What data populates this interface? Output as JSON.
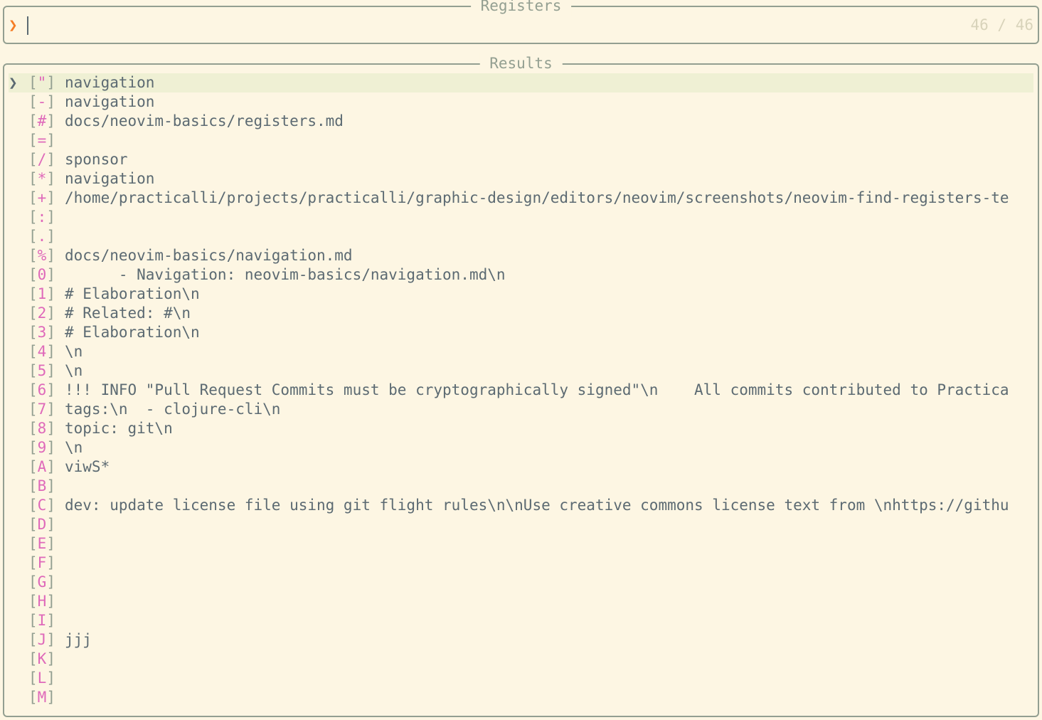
{
  "prompt": {
    "title": "Registers",
    "caret": "❯",
    "value": "",
    "count": "46 / 46"
  },
  "results": {
    "title": "Results",
    "selected_marker": "❯",
    "rows": [
      {
        "reg": "\"",
        "value": "navigation",
        "selected": true
      },
      {
        "reg": "-",
        "value": "navigation"
      },
      {
        "reg": "#",
        "value": "docs/neovim-basics/registers.md"
      },
      {
        "reg": "=",
        "value": ""
      },
      {
        "reg": "/",
        "value": "sponsor"
      },
      {
        "reg": "*",
        "value": "navigation"
      },
      {
        "reg": "+",
        "value": "/home/practicalli/projects/practicalli/graphic-design/editors/neovim/screenshots/neovim-find-registers-te"
      },
      {
        "reg": ":",
        "value": ""
      },
      {
        "reg": ".",
        "value": ""
      },
      {
        "reg": "%",
        "value": "docs/neovim-basics/navigation.md"
      },
      {
        "reg": "0",
        "value": "      - Navigation: neovim-basics/navigation.md\\n"
      },
      {
        "reg": "1",
        "value": "# Elaboration\\n"
      },
      {
        "reg": "2",
        "value": "# Related: #\\n"
      },
      {
        "reg": "3",
        "value": "# Elaboration\\n"
      },
      {
        "reg": "4",
        "value": "\\n"
      },
      {
        "reg": "5",
        "value": "\\n"
      },
      {
        "reg": "6",
        "value": "!!! INFO \"Pull Request Commits must be cryptographically signed\"\\n    All commits contributed to Practica"
      },
      {
        "reg": "7",
        "value": "tags:\\n  - clojure-cli\\n"
      },
      {
        "reg": "8",
        "value": "topic: git\\n"
      },
      {
        "reg": "9",
        "value": "\\n"
      },
      {
        "reg": "A",
        "value": "viwS*"
      },
      {
        "reg": "B",
        "value": ""
      },
      {
        "reg": "C",
        "value": "dev: update license file using git flight rules\\n\\nUse creative commons license text from \\nhttps://githu"
      },
      {
        "reg": "D",
        "value": ""
      },
      {
        "reg": "E",
        "value": ""
      },
      {
        "reg": "F",
        "value": ""
      },
      {
        "reg": "G",
        "value": ""
      },
      {
        "reg": "H",
        "value": ""
      },
      {
        "reg": "I",
        "value": ""
      },
      {
        "reg": "J",
        "value": "jjj"
      },
      {
        "reg": "K",
        "value": ""
      },
      {
        "reg": "L",
        "value": ""
      },
      {
        "reg": "M",
        "value": ""
      }
    ]
  },
  "colors": {
    "background": "#fdf6e3",
    "border": "#939f91",
    "text": "#5c6a72",
    "register": "#df69ba",
    "caret": "#f57d26",
    "selection": "#eff0d4",
    "counter": "#d8d3ba"
  }
}
